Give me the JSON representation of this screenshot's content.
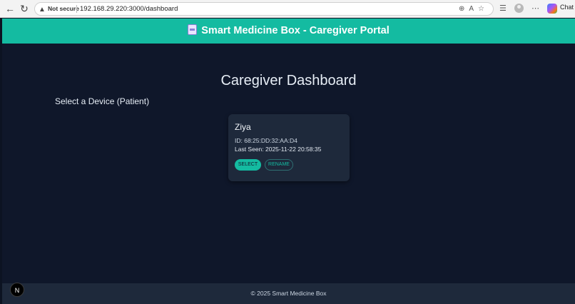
{
  "browser": {
    "not_secure": "Not secure",
    "url": "192.168.29.220:3000/dashboard",
    "chat_label": "Chat",
    "icons": [
      "back-icon",
      "reload-icon",
      "warning-icon",
      "zoom-icon",
      "read-aloud-icon",
      "favorite-icon",
      "favorites-icon",
      "profile-icon",
      "more-icon",
      "copilot-icon"
    ]
  },
  "header": {
    "title": "Smart Medicine Box - Caregiver Portal",
    "icon": "pill-box-icon"
  },
  "main": {
    "heading": "Caregiver Dashboard",
    "select_label": "Select a Device (Patient)",
    "devices": [
      {
        "name": "Ziya",
        "id_text": "ID: 68:25:DD:32:AA:D4",
        "last_seen_text": "Last Seen: 2025-11-22 20:58:35",
        "select_label": "SELECT",
        "rename_label": "RENAME"
      }
    ]
  },
  "footer": {
    "text": "© 2025 Smart Medicine Box"
  },
  "dev_badge": {
    "label": "N"
  },
  "colors": {
    "accent": "#14bba1",
    "background": "#0f172a",
    "card": "#1e293b"
  }
}
